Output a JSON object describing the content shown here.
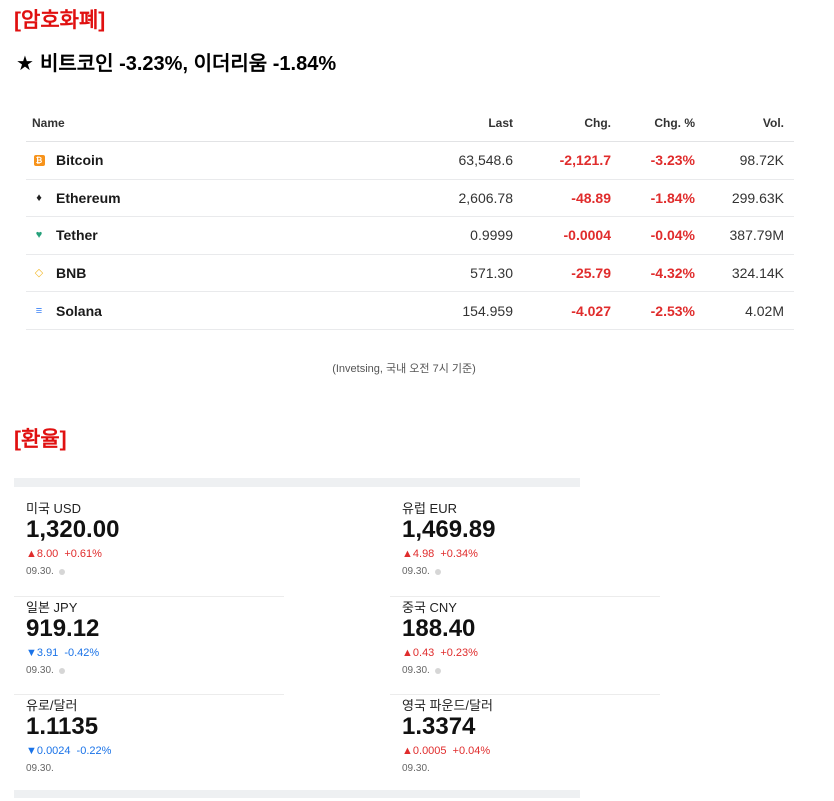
{
  "crypto": {
    "section_title": "[암호화폐]",
    "headline_star": "★",
    "headline": "비트코인 -3.23%, 이더리움 -1.84%",
    "columns": {
      "name": "Name",
      "last": "Last",
      "chg": "Chg.",
      "pct": "Chg. %",
      "vol": "Vol."
    },
    "rows": [
      {
        "name": "Bitcoin",
        "icon": "bitcoin-icon",
        "glyph": "₿",
        "last": "63,548.6",
        "chg": "-2,121.7",
        "pct": "-3.23%",
        "vol": "98.72K"
      },
      {
        "name": "Ethereum",
        "icon": "ethereum-icon",
        "glyph": "♦",
        "last": "2,606.78",
        "chg": "-48.89",
        "pct": "-1.84%",
        "vol": "299.63K"
      },
      {
        "name": "Tether",
        "icon": "tether-icon",
        "glyph": "♥",
        "last": "0.9999",
        "chg": "-0.0004",
        "pct": "-0.04%",
        "vol": "387.79M"
      },
      {
        "name": "BNB",
        "icon": "bnb-icon",
        "glyph": "◇",
        "last": "571.30",
        "chg": "-25.79",
        "pct": "-4.32%",
        "vol": "324.14K"
      },
      {
        "name": "Solana",
        "icon": "solana-icon",
        "glyph": "≡",
        "last": "154.959",
        "chg": "-4.027",
        "pct": "-2.53%",
        "vol": "4.02M"
      }
    ],
    "icon_colors": {
      "bitcoin": "#f7931a",
      "ethereum": "#222222",
      "tether": "#26a17b",
      "bnb": "#f3ba2f",
      "solana": "#3b82f6"
    },
    "change_color": "#e02c2c",
    "source_note": "(Invetsing, 국내 오전 7시 기준)"
  },
  "fx": {
    "section_title": "[환율]",
    "up_color": "#e02c2c",
    "down_color": "#1a73e8",
    "cells": [
      {
        "label": "미국 USD",
        "value": "1,320.00",
        "dir": "up",
        "arrow": "▲",
        "chg": "8.00",
        "pct": "+0.61%",
        "date": "09.30.",
        "dot": true
      },
      {
        "label": "유럽 EUR",
        "value": "1,469.89",
        "dir": "up",
        "arrow": "▲",
        "chg": "4.98",
        "pct": "+0.34%",
        "date": "09.30.",
        "dot": true
      },
      {
        "label": "일본 JPY",
        "value": "919.12",
        "dir": "down",
        "arrow": "▼",
        "chg": "3.91",
        "pct": "-0.42%",
        "date": "09.30.",
        "dot": true
      },
      {
        "label": "중국 CNY",
        "value": "188.40",
        "dir": "up",
        "arrow": "▲",
        "chg": "0.43",
        "pct": "+0.23%",
        "date": "09.30.",
        "dot": true
      },
      {
        "label": "유로/달러",
        "value": "1.1135",
        "dir": "down",
        "arrow": "▼",
        "chg": "0.0024",
        "pct": "-0.22%",
        "date": "09.30.",
        "dot": false
      },
      {
        "label": "영국 파운드/달러",
        "value": "1.3374",
        "dir": "up",
        "arrow": "▲",
        "chg": "0.0005",
        "pct": "+0.04%",
        "date": "09.30.",
        "dot": false
      }
    ]
  }
}
